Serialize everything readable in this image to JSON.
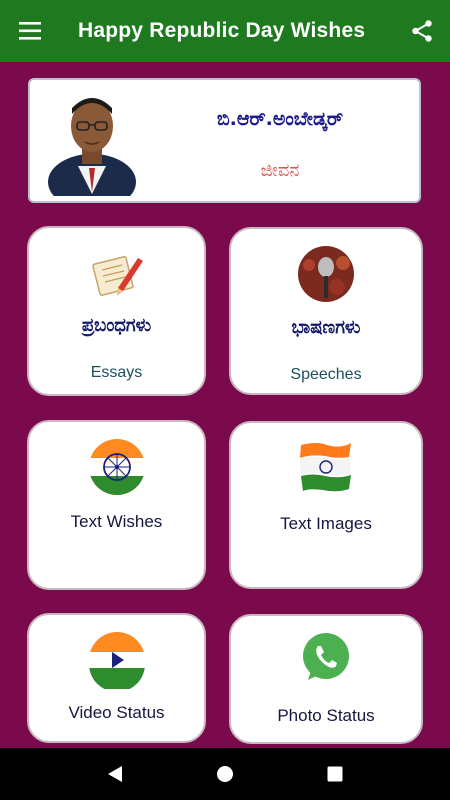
{
  "app": {
    "title": "Happy Republic Day Wishes",
    "menu_icon": "hamburger-menu-icon",
    "share_icon": "share-icon",
    "bar_color": "#1f7a1f",
    "background_color": "#7b0a4d"
  },
  "profile": {
    "name": "ಬಿ.ಆರ್.ಅಂಬೇಡ್ಕರ್",
    "subtitle": "ಜೀವನ"
  },
  "cards": [
    {
      "kannada": "ಪ್ರಬಂಧಗಳು",
      "english": "Essays",
      "icon": "writing-pen-icon"
    },
    {
      "kannada": "ಭಾಷಣಗಳು",
      "english": "Speeches",
      "icon": "microphone-icon"
    },
    {
      "english": "Text Wishes",
      "icon": "ashoka-chakra-flag-icon"
    },
    {
      "english": "Text Images",
      "icon": "flag-brush-icon"
    },
    {
      "english": "Video Status",
      "icon": "video-play-flag-icon"
    },
    {
      "english": "Photo Status",
      "icon": "whatsapp-icon"
    }
  ],
  "navbar": {
    "back_icon": "back-triangle-icon",
    "home_icon": "home-circle-icon",
    "recents_icon": "recents-square-icon"
  }
}
